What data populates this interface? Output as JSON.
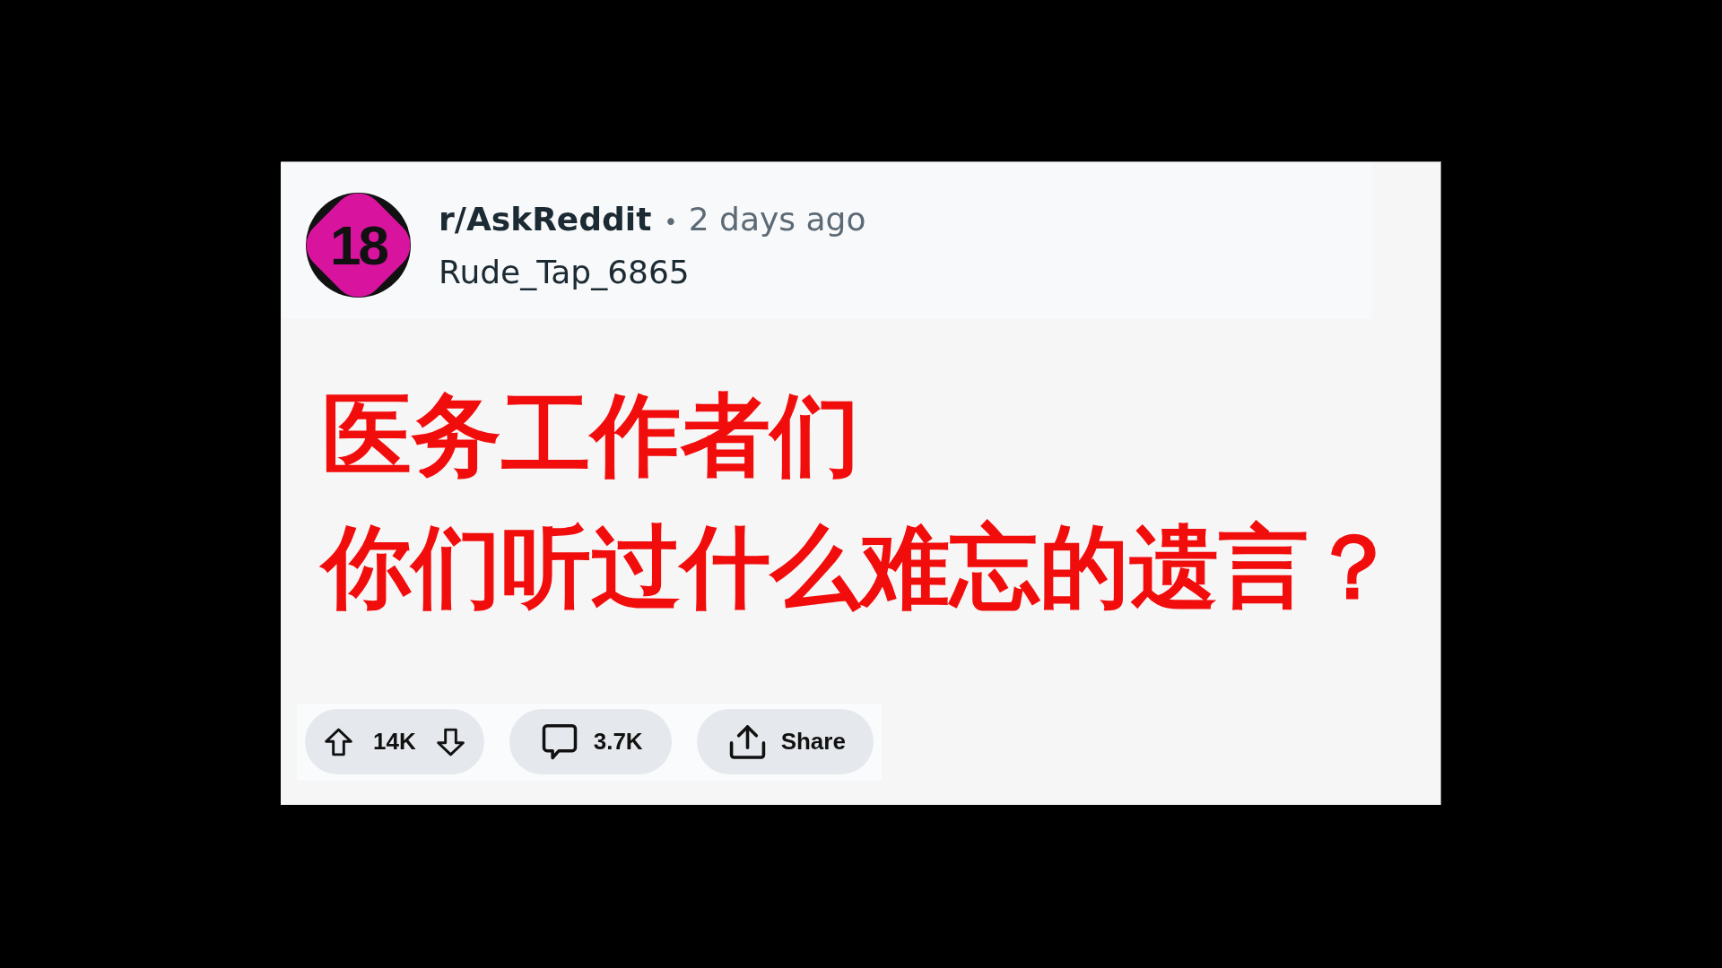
{
  "post": {
    "avatar": {
      "text": "18"
    },
    "subreddit": "r/AskReddit",
    "separator": "•",
    "time": "2 days ago",
    "author": "Rude_Tap_6865",
    "title_lines": [
      "医务工作者们",
      "你们听过什么难忘的遗言？"
    ]
  },
  "actions": {
    "votes": "14K",
    "comments": "3.7K",
    "share": "Share"
  }
}
